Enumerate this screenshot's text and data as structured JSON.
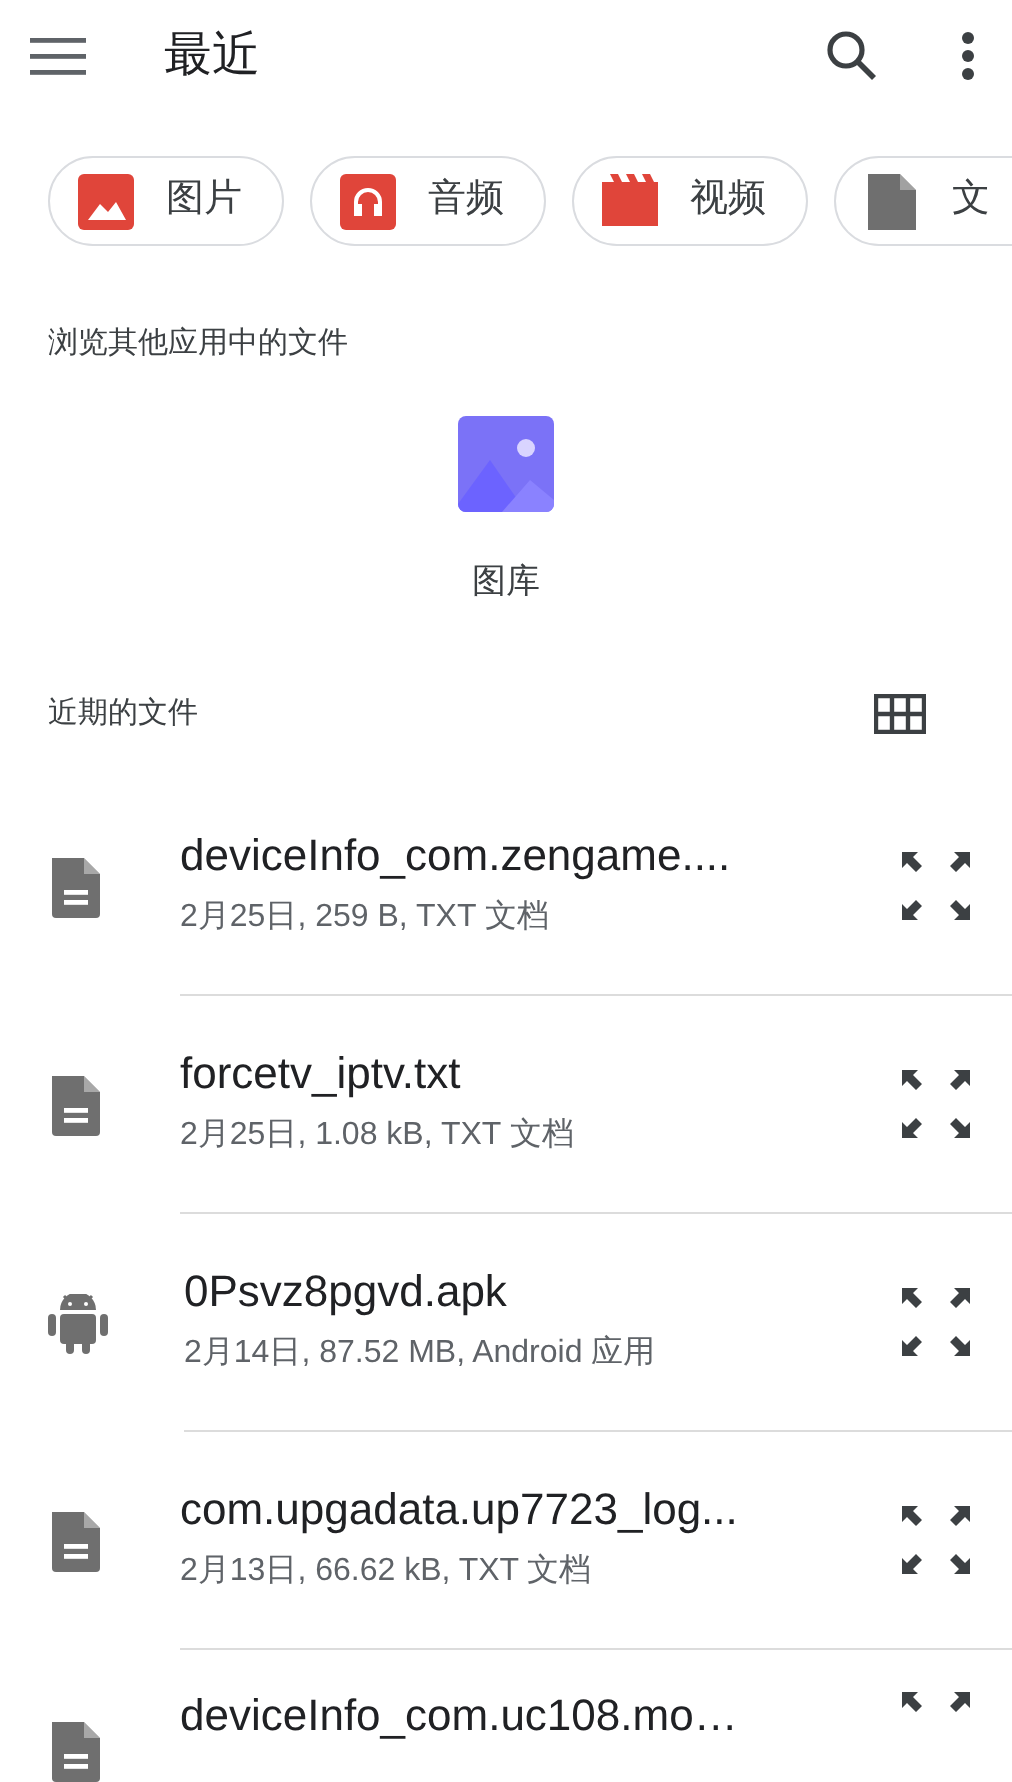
{
  "app_bar": {
    "title": "最近"
  },
  "chips": [
    {
      "kind": "image",
      "label": "图片"
    },
    {
      "kind": "audio",
      "label": "音频"
    },
    {
      "kind": "video",
      "label": "视频"
    },
    {
      "kind": "document",
      "label": "文"
    }
  ],
  "other_apps": {
    "heading": "浏览其他应用中的文件",
    "apps": [
      {
        "label": "图库"
      }
    ]
  },
  "recent": {
    "heading": "近期的文件"
  },
  "files": [
    {
      "kind": "text",
      "name": "deviceInfo_com.zengame....",
      "meta": "2月25日, 259 B, TXT 文档"
    },
    {
      "kind": "text",
      "name": "forcetv_iptv.txt",
      "meta": "2月25日, 1.08 kB, TXT 文档"
    },
    {
      "kind": "apk",
      "name": "0Psvz8pgvd.apk",
      "meta": "2月14日, 87.52 MB, Android 应用"
    },
    {
      "kind": "text",
      "name": "com.upgadata.up7723_log...",
      "meta": "2月13日, 66.62 kB, TXT 文档"
    },
    {
      "kind": "text",
      "name": "deviceInfo_com.uc108.mo…"
    }
  ]
}
